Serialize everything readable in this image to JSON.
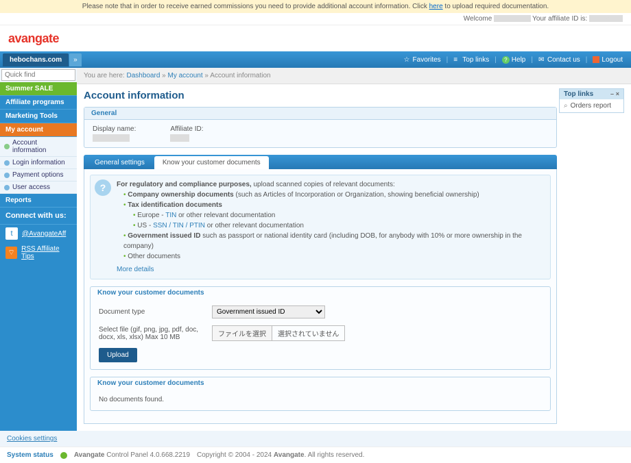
{
  "notice": {
    "text_before": "Please note that in order to receive earned commissions you need to provide additional account information. Click ",
    "link": "here",
    "text_after": " to upload required documentation."
  },
  "welcome": {
    "prefix": "Welcome ",
    "suffix": " Your affiliate ID is: "
  },
  "logo": "avangate",
  "site_tab": "hebochans.com",
  "topnav": {
    "fav": "Favorites",
    "top": "Top links",
    "help": "Help",
    "contact": "Contact us",
    "logout": "Logout"
  },
  "quickfind_placeholder": "Quick find",
  "sidebar": [
    {
      "label": "Summer SALE",
      "cls": "green"
    },
    {
      "label": "Affiliate programs"
    },
    {
      "label": "Marketing Tools"
    },
    {
      "label": "My account",
      "cls": "active"
    },
    {
      "label": "Reports"
    }
  ],
  "subitems": [
    {
      "label": "Account information",
      "dot": ""
    },
    {
      "label": "Login information",
      "dot": "blue"
    },
    {
      "label": "Payment options",
      "dot": "blue"
    },
    {
      "label": "User access",
      "dot": "blue"
    }
  ],
  "connect": {
    "title": "Connect with us:",
    "twitter": "@AvangateAff",
    "rss": "RSS Affiliate Tips"
  },
  "breadcrumb": {
    "prefix": "You are here: ",
    "dash": "Dashboard",
    "sep": " » ",
    "acc": "My account",
    "cur": "Account information"
  },
  "page_title": "Account information",
  "general": {
    "hd": "General",
    "display": "Display name:",
    "affid": "Affiliate ID:"
  },
  "tabs": {
    "gen": "General settings",
    "kyc": "Know your customer documents"
  },
  "info": {
    "lead_b": "For regulatory and compliance purposes,",
    "lead": " upload scanned copies of relevant documents:",
    "li1_b": "Company ownership documents",
    "li1": " (such as Articles of Incorporation or Organization, showing beneficial ownership)",
    "li2_b": "Tax identification documents",
    "li2a_pre": "Europe - ",
    "li2a_link": "TIN",
    "li2a_post": " or other relevant documentation",
    "li2b_pre": "US - ",
    "li2b_link": "SSN / TIN / PTIN",
    "li2b_post": " or other relevant documentation",
    "li3_b": "Government issued ID",
    "li3": " such as passport or national identity card (including DOB, for anybody with 10% or more ownership in the company)",
    "li4": "Other documents",
    "more": "More details"
  },
  "kyc": {
    "hd": "Know your customer documents",
    "doctype_lbl": "Document type",
    "doctype_val": "Government issued ID",
    "file_lbl": "Select file (gif, png, jpg, pdf, doc, docx, xls, xlsx) Max 10 MB",
    "file_btn": "ファイルを選択",
    "file_none": "選択されていません",
    "upload": "Upload",
    "nodocs": "No documents found."
  },
  "toplinks": {
    "hd": "Top links",
    "item": "Orders report"
  },
  "cookies": "Cookies settings",
  "footer": {
    "status": "System status",
    "product_b": "Avangate",
    "product": " Control Panel 4.0.668.2219",
    "copy": "Copyright © 2004 - 2024 ",
    "copy_b": "Avangate",
    "copy_end": ". All rights reserved."
  }
}
